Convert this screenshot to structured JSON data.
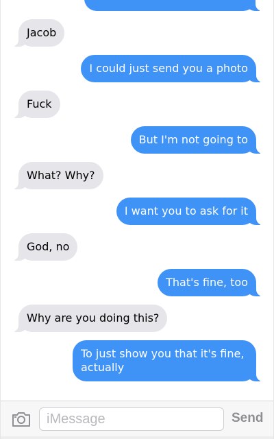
{
  "thread": {
    "messages": [
      {
        "direction": "in",
        "text": "Jacob"
      },
      {
        "direction": "out",
        "text": "I could just send you a photo"
      },
      {
        "direction": "in",
        "text": "Fuck"
      },
      {
        "direction": "out",
        "text": "But I'm not going to"
      },
      {
        "direction": "in",
        "text": "What? Why?"
      },
      {
        "direction": "out",
        "text": "I want you to ask for it"
      },
      {
        "direction": "in",
        "text": "God, no"
      },
      {
        "direction": "out",
        "text": "That's fine, too"
      },
      {
        "direction": "in",
        "text": "Why are you doing this?"
      },
      {
        "direction": "out",
        "text": "To just show you that it's fine, actually"
      }
    ],
    "incoming_color": "#e5e5ea",
    "outgoing_color": "#3f92f6"
  },
  "composer": {
    "placeholder": "iMessage",
    "send_label": "Send",
    "camera_icon": "camera-icon"
  }
}
